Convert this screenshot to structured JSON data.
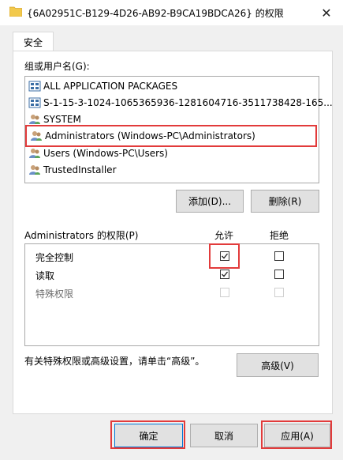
{
  "window": {
    "title": "{6A02951C-B129-4D26-AB92-B9CA19BDCA26} 的权限",
    "close_glyph": "✕"
  },
  "tabs": [
    {
      "label": "安全"
    }
  ],
  "groups": {
    "label": "组或用户名(G):",
    "items": [
      {
        "label": "ALL APPLICATION PACKAGES",
        "icon": "package-icon"
      },
      {
        "label": "S-1-15-3-1024-1065365936-1281604716-3511738428-165...",
        "icon": "capability-icon"
      },
      {
        "label": "SYSTEM",
        "icon": "users-icon"
      },
      {
        "label": "Administrators (Windows-PC\\Administrators)",
        "icon": "users-icon",
        "highlighted": true
      },
      {
        "label": "Users (Windows-PC\\Users)",
        "icon": "users-icon"
      },
      {
        "label": "TrustedInstaller",
        "icon": "users-icon"
      }
    ],
    "add_label": "添加(D)...",
    "remove_label": "删除(R)"
  },
  "permissions": {
    "header": "Administrators 的权限(P)",
    "allow_label": "允许",
    "deny_label": "拒绝",
    "rows": [
      {
        "label": "完全控制",
        "allow": true,
        "deny": false,
        "enabled": true
      },
      {
        "label": "读取",
        "allow": true,
        "deny": false,
        "enabled": true
      },
      {
        "label": "特殊权限",
        "allow": false,
        "deny": false,
        "enabled": false
      }
    ]
  },
  "advanced": {
    "text": "有关特殊权限或高级设置，请单击“高级”。",
    "button_label": "高级(V)"
  },
  "footer": {
    "ok_label": "确定",
    "cancel_label": "取消",
    "apply_label": "应用(A)"
  },
  "colors": {
    "highlight": "#e23b3b",
    "dialog_bg": "#f0f0f0",
    "folder": "#f2c94c"
  }
}
